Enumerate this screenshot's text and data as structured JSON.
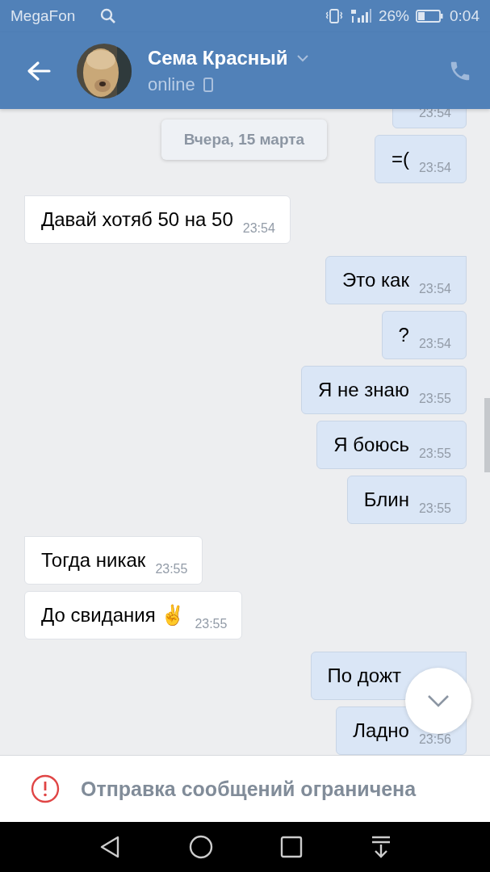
{
  "status_bar": {
    "carrier": "MegaFon",
    "battery": "26%",
    "time": "0:04"
  },
  "header": {
    "name": "Сема Красный",
    "status": "online"
  },
  "date_chip": "Вчера, 15 марта",
  "messages": [
    {
      "kind": "out",
      "time": "23:54",
      "tail": false
    },
    {
      "kind": "out",
      "text": "=(",
      "time": "23:54",
      "tail": false
    },
    {
      "kind": "in",
      "text": "Давай хотяб 50 на 50",
      "time": "23:54",
      "tail": true
    },
    {
      "kind": "out",
      "text": "Это как",
      "time": "23:54",
      "tail": true
    },
    {
      "kind": "out",
      "text": "?",
      "time": "23:54",
      "tail": false
    },
    {
      "kind": "out",
      "text": "Я не знаю",
      "time": "23:55",
      "tail": false
    },
    {
      "kind": "out",
      "text": "Я боюсь",
      "time": "23:55",
      "tail": false
    },
    {
      "kind": "out",
      "text": "Блин",
      "time": "23:55",
      "tail": false
    },
    {
      "kind": "in",
      "text": "Тогда никак",
      "time": "23:55",
      "tail": true
    },
    {
      "kind": "in",
      "text": "До свидания ✌",
      "time": "23:55",
      "tail": false
    },
    {
      "kind": "out",
      "text": "По дожт",
      "tail": true
    },
    {
      "kind": "out",
      "text": "Ладно",
      "time": "23:56",
      "tail": false
    }
  ],
  "footer": {
    "notice": "Отправка сообщений ограничена"
  }
}
